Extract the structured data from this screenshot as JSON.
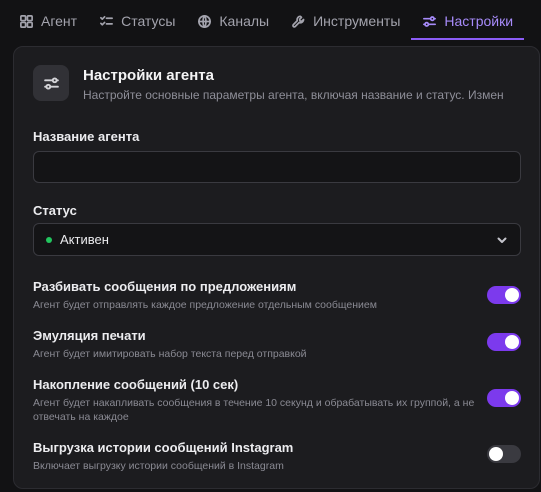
{
  "tabs": [
    {
      "label": "Агент",
      "icon": "grid-icon"
    },
    {
      "label": "Статусы",
      "icon": "list-check-icon"
    },
    {
      "label": "Каналы",
      "icon": "globe-icon"
    },
    {
      "label": "Инструменты",
      "icon": "wrench-icon"
    },
    {
      "label": "Настройки",
      "icon": "sliders-icon"
    }
  ],
  "active_tab": "Настройки",
  "colors": {
    "accent": "#8b5cf6",
    "status_active": "#22c55e"
  },
  "settings": {
    "title": "Настройки агента",
    "subtitle": "Настройте основные параметры агента, включая название и статус. Измен",
    "name_label": "Название агента",
    "name_value": "",
    "status_label": "Статус",
    "status_value": "Активен",
    "options": [
      {
        "title": "Разбивать сообщения по предложениям",
        "desc": "Агент будет отправлять каждое предложение отдельным сообщением",
        "enabled": true
      },
      {
        "title": "Эмуляция печати",
        "desc": "Агент будет имитировать набор текста перед отправкой",
        "enabled": true
      },
      {
        "title": "Накопление сообщений (10 сек)",
        "desc": "Агент будет накапливать сообщения в течение 10 секунд и обрабатывать их группой, а не отвечать на каждое",
        "enabled": true
      },
      {
        "title": "Выгрузка истории сообщений Instagram",
        "desc": "Включает выгрузку истории сообщений в Instagram",
        "enabled": false
      }
    ]
  }
}
